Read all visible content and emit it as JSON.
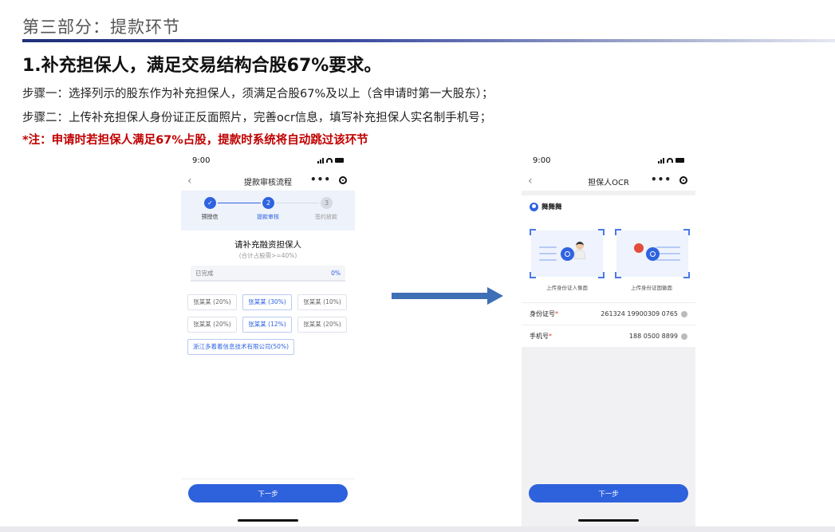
{
  "slide": {
    "section_title": "第三部分：提款环节",
    "heading": "1.补充担保人，满足交易结构合股67%要求。",
    "step1": "步骤一：选择列示的股东作为补充担保人，须满足合股67%及以上（含申请时第一大股东）；",
    "step2": "步骤二：上传补充担保人身份证正反面照片，完善ocr信息，填写补充担保人实名制手机号；",
    "note": "*注：申请时若担保人满足67%占股，提款时系统将自动跳过该环节"
  },
  "colors": {
    "accent": "#2e61dc",
    "note_red": "#c00000",
    "arrow": "#3f6fb5"
  },
  "phone1": {
    "time": "9:00",
    "nav_title": "提款审核流程",
    "more": "•••",
    "steps": [
      {
        "num": "✓",
        "label": "预授信"
      },
      {
        "num": "2",
        "label": "提款审核"
      },
      {
        "num": "3",
        "label": "签约放款"
      }
    ],
    "card_title": "请补充融资担保人",
    "card_sub": "(合计占股需>=40%)",
    "done_label": "已完成",
    "done_pct": "0%",
    "chips": [
      "张某某 (20%)",
      "张某某 (30%)",
      "张某某 (10%)",
      "张某某 (20%)",
      "张某某 (12%)",
      "张某某 (20%)",
      "浙江多着着信息技术有限公司(50%)"
    ],
    "next_label": "下一步"
  },
  "phone2": {
    "time": "9:00",
    "nav_title": "担保人OCR",
    "more": "•••",
    "user_name": "舞舞舞",
    "front_label": "上传身份证人像面",
    "back_label": "上传身份证国徽面",
    "id_label": "身份证号",
    "id_value": "261324 19900309 0765",
    "phone_label": "手机号",
    "phone_value": "188 0500 8899",
    "required_mark": "*",
    "next_label": "下一步"
  }
}
